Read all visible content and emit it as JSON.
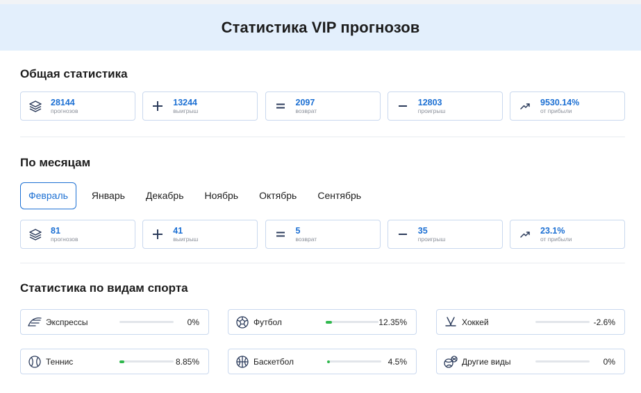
{
  "header": {
    "title": "Статистика VIP прогнозов"
  },
  "general": {
    "title": "Общая статистика",
    "stats": [
      {
        "value": "28144",
        "label": "прогнозов",
        "icon": "layers-icon"
      },
      {
        "value": "13244",
        "label": "выигрыш",
        "icon": "plus-icon"
      },
      {
        "value": "2097",
        "label": "возврат",
        "icon": "equals-icon"
      },
      {
        "value": "12803",
        "label": "проигрыш",
        "icon": "minus-icon"
      },
      {
        "value": "9530.14%",
        "label": "от прибыли",
        "icon": "trend-up-icon"
      }
    ]
  },
  "monthly": {
    "title": "По месяцам",
    "tabs": [
      "Февраль",
      "Январь",
      "Декабрь",
      "Ноябрь",
      "Октябрь",
      "Сентябрь"
    ],
    "active_tab": "Февраль",
    "stats": [
      {
        "value": "81",
        "label": "прогнозов",
        "icon": "layers-icon"
      },
      {
        "value": "41",
        "label": "выигрыш",
        "icon": "plus-icon"
      },
      {
        "value": "5",
        "label": "возврат",
        "icon": "equals-icon"
      },
      {
        "value": "35",
        "label": "проигрыш",
        "icon": "minus-icon"
      },
      {
        "value": "23.1%",
        "label": "от прибыли",
        "icon": "trend-up-icon"
      }
    ]
  },
  "sports": {
    "title": "Статистика по видам спорта",
    "items": [
      {
        "name": "Экспрессы",
        "value": "0%",
        "fill_percent": 0,
        "icon": "express-icon"
      },
      {
        "name": "Футбол",
        "value": "12.35%",
        "fill_percent": 12.35,
        "icon": "football-icon"
      },
      {
        "name": "Хоккей",
        "value": "-2.6%",
        "fill_percent": 0,
        "icon": "hockey-icon"
      },
      {
        "name": "Теннис",
        "value": "8.85%",
        "fill_percent": 8.85,
        "icon": "tennis-icon"
      },
      {
        "name": "Баскетбол",
        "value": "4.5%",
        "fill_percent": 4.5,
        "icon": "basketball-icon"
      },
      {
        "name": "Другие виды",
        "value": "0%",
        "fill_percent": 0,
        "icon": "other-sports-icon"
      }
    ]
  },
  "colors": {
    "accent": "#1b6fd3",
    "header_bg": "#e3effc",
    "card_border": "#c9d8ee",
    "bar_fill": "#2fb84d"
  }
}
